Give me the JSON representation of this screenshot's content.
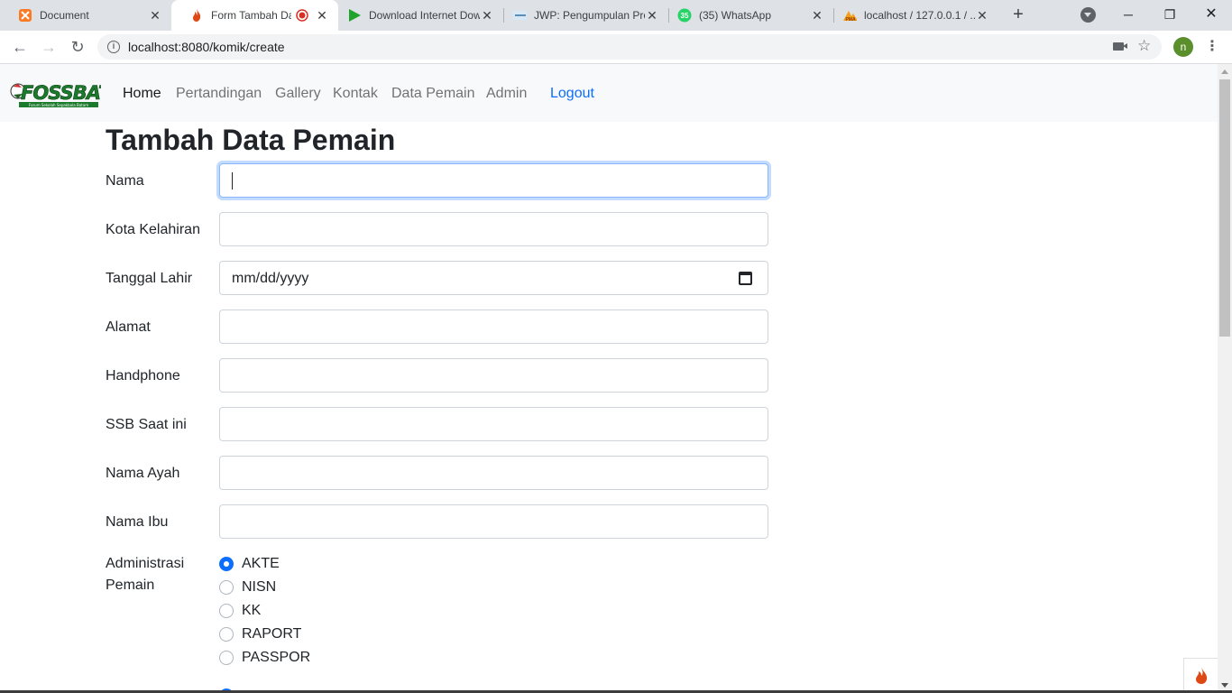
{
  "browser": {
    "tabs": [
      {
        "title": "Document",
        "favicon": "xampp-icon",
        "active": false
      },
      {
        "title": "Form Tambah Data Pemain",
        "favicon": "codeigniter-flame-icon",
        "active": true,
        "recording": true
      },
      {
        "title": "Download Internet Download Manager",
        "favicon": "idm-play-icon",
        "active": false
      },
      {
        "title": "JWP: Pengumpulan Proyek",
        "favicon": "jwp-icon",
        "active": false
      },
      {
        "title": "(35) WhatsApp",
        "favicon": "whatsapp-icon",
        "badge": "35",
        "active": false
      },
      {
        "title": "localhost / 127.0.0.1 / ...",
        "favicon": "phpmyadmin-icon",
        "active": false
      }
    ],
    "url": "localhost:8080/komik/create",
    "profile_initial": "n",
    "colors": {
      "tabstrip": "#dee1e6",
      "profile": "#5a8f2c"
    }
  },
  "navbar": {
    "logo_text": "FOSSBAT",
    "logo_subtext": "Forum Sekolah Sepakbola Batam",
    "links": [
      {
        "label": "Home",
        "active": true
      },
      {
        "label": "Pertandingan",
        "active": false
      },
      {
        "label": "Gallery",
        "active": false
      },
      {
        "label": "Kontak",
        "active": false
      },
      {
        "label": "Data Pemain",
        "active": false
      },
      {
        "label": "Admin",
        "active": false
      }
    ],
    "logout": "Logout",
    "colors": {
      "logout": "#0d6efd"
    }
  },
  "form": {
    "title": "Tambah Data Pemain",
    "fields": [
      {
        "label": "Nama",
        "value": "",
        "focused": true
      },
      {
        "label": "Kota Kelahiran",
        "value": ""
      },
      {
        "label": "Tanggal Lahir",
        "value": "",
        "placeholder": "mm/dd/yyyy",
        "type": "date"
      },
      {
        "label": "Alamat",
        "value": ""
      },
      {
        "label": "Handphone",
        "value": ""
      },
      {
        "label": "SSB Saat ini",
        "value": ""
      },
      {
        "label": "Nama Ayah",
        "value": ""
      },
      {
        "label": "Nama Ibu",
        "value": ""
      }
    ],
    "administrasi": {
      "label": "Administrasi Pemain",
      "options": [
        {
          "label": "AKTE",
          "checked": true
        },
        {
          "label": "NISN",
          "checked": false
        },
        {
          "label": "KK",
          "checked": false
        },
        {
          "label": "RAPORT",
          "checked": false
        },
        {
          "label": "PASSPOR",
          "checked": false
        }
      ]
    },
    "colors": {
      "radio_checked": "#0d6efd",
      "focus_border": "#86b7fe"
    }
  }
}
